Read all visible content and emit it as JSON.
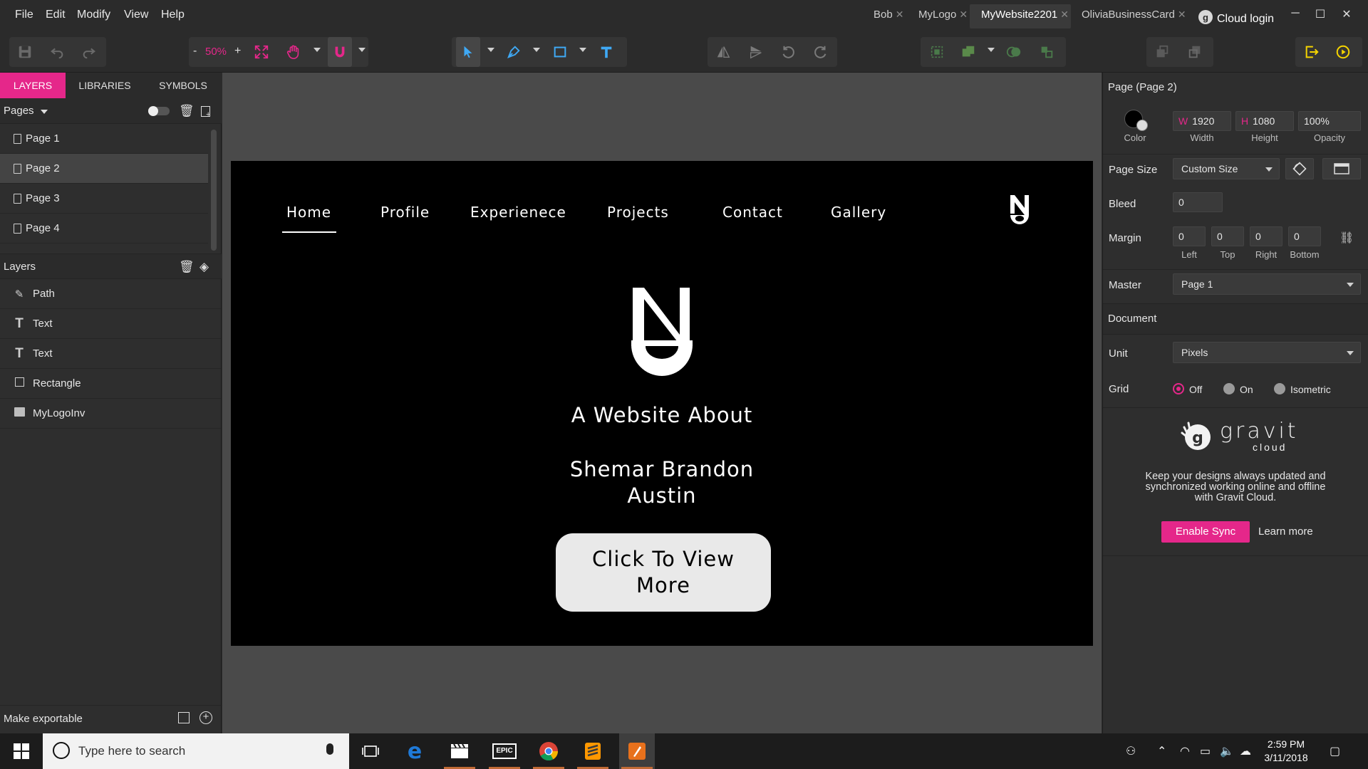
{
  "menu": [
    "File",
    "Edit",
    "Modify",
    "View",
    "Help"
  ],
  "doc_tabs": [
    {
      "label": "Bob"
    },
    {
      "label": "MyLogo"
    },
    {
      "label": "MyWebsite2201",
      "active": true
    },
    {
      "label": "OliviaBusinessCard"
    }
  ],
  "cloud_login": "Cloud login",
  "toolbar": {
    "zoom": "50%",
    "zoom_minus": "-",
    "zoom_plus": "+"
  },
  "left_panel": {
    "tabs": [
      "LAYERS",
      "LIBRARIES",
      "SYMBOLS"
    ],
    "pages_label": "Pages",
    "pages": [
      "Page 1",
      "Page 2",
      "Page 3",
      "Page 4"
    ],
    "selected_page": "Page 2",
    "layers_label": "Layers",
    "layers": [
      {
        "name": "Path",
        "icon": "pen-icon"
      },
      {
        "name": "Text",
        "icon": "text-icon"
      },
      {
        "name": "Text",
        "icon": "text-icon"
      },
      {
        "name": "Rectangle",
        "icon": "rectangle-icon"
      },
      {
        "name": "MyLogoInv",
        "icon": "image-icon"
      }
    ],
    "make_exportable": "Make exportable"
  },
  "artboard": {
    "nav": [
      "Home",
      "Profile",
      "Experienece",
      "Projects",
      "Contact",
      "Gallery"
    ],
    "active_nav": "Home",
    "subtitle": "A Website About",
    "name_line1": "Shemar Brandon",
    "name_line2": "Austin",
    "cta_line1": "Click To View",
    "cta_line2": "More"
  },
  "right_panel": {
    "title": "Page (Page 2)",
    "color_label": "Color",
    "width_prefix": "W",
    "width": "1920",
    "width_label": "Width",
    "height_prefix": "H",
    "height": "1080",
    "height_label": "Height",
    "opacity": "100%",
    "opacity_label": "Opacity",
    "page_size_label": "Page Size",
    "page_size": "Custom Size",
    "bleed_label": "Bleed",
    "bleed": "0",
    "margin_label": "Margin",
    "margins": [
      {
        "value": "0",
        "label": "Left"
      },
      {
        "value": "0",
        "label": "Top"
      },
      {
        "value": "0",
        "label": "Right"
      },
      {
        "value": "0",
        "label": "Bottom"
      }
    ],
    "master_label": "Master",
    "master": "Page 1",
    "document_label": "Document",
    "unit_label": "Unit",
    "unit": "Pixels",
    "grid_label": "Grid",
    "grid_options": [
      "Off",
      "On",
      "Isometric"
    ],
    "grid_selected": "Off",
    "gravit_brand": "gravit",
    "gravit_sub": "cloud",
    "promo": "Keep your designs always updated and synchronized working online and offline with Gravit Cloud.",
    "enable_sync": "Enable Sync",
    "learn_more": "Learn more"
  },
  "taskbar": {
    "search_placeholder": "Type here to search",
    "time": "2:59 PM",
    "date": "3/11/2018"
  },
  "colors": {
    "accent": "#e5278a",
    "canvas": "#4a4a4a",
    "panel": "#2e2e2e"
  }
}
